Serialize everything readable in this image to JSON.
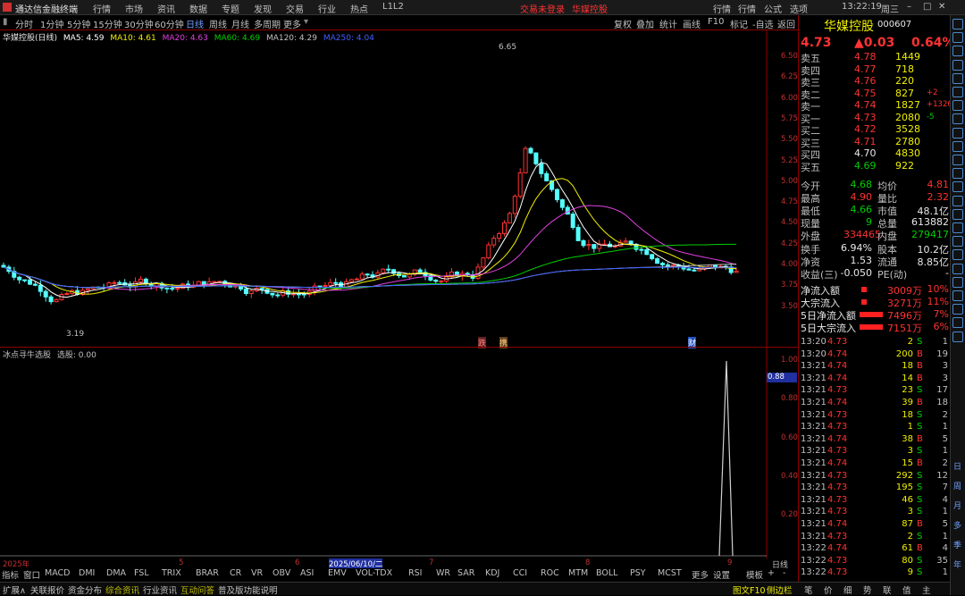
{
  "window": {
    "app": "通达信金融终端",
    "menus": [
      "行情",
      "市场",
      "资讯",
      "数据",
      "专题",
      "发现",
      "交易",
      "行业",
      "热点",
      "L1L2"
    ],
    "notice": "交易未登录",
    "stock_name_title": "华媒控股",
    "right_menus": [
      "行情",
      "行情",
      "公式",
      "选项"
    ],
    "clock": "13:22:19",
    "weekday": "周三"
  },
  "periods": [
    "分时",
    "1分钟",
    "5分钟",
    "15分钟",
    "30分钟",
    "60分钟",
    "日线",
    "周线",
    "月线",
    "多周期",
    "更多"
  ],
  "toolbar_right": [
    "复权",
    "叠加",
    "统计",
    "画线",
    "F10",
    "标记",
    "-自选",
    "返回"
  ],
  "chart": {
    "title": "华媒控股(日线)",
    "ma": [
      {
        "label": "MA5: 4.59",
        "color": "#ffffff"
      },
      {
        "label": "MA10: 4.61",
        "color": "#f0f000"
      },
      {
        "label": "MA20: 4.63",
        "color": "#e040e0"
      },
      {
        "label": "MA60: 4.69",
        "color": "#00d000"
      },
      {
        "label": "MA120: 4.29",
        "color": "#c0c0c0"
      },
      {
        "label": "MA250: 4.04",
        "color": "#4060ff"
      }
    ],
    "y_ticks": [
      "6.50",
      "6.25",
      "6.00",
      "5.75",
      "5.50",
      "5.25",
      "5.00",
      "4.75",
      "4.50",
      "4.25",
      "4.00",
      "3.75",
      "3.50"
    ],
    "high_label": "6.65",
    "low_label": "3.19",
    "markers": [
      "跌",
      "携",
      "财"
    ]
  },
  "indicator": {
    "title": "冰点寻牛选股",
    "value_label": "选股: 0.00",
    "current": "0.88",
    "y_ticks": [
      "1.00",
      "0.80",
      "0.60",
      "0.40",
      "0.20"
    ]
  },
  "x_axis": {
    "labels": [
      "2025年",
      "5",
      "6",
      "2025/06/10/二",
      "7",
      "8",
      "9"
    ],
    "right": "日线"
  },
  "indicator_tabs": [
    "指标",
    "窗口",
    "MACD",
    "DMI",
    "DMA",
    "FSL",
    "TRIX",
    "BRAR",
    "CR",
    "VR",
    "OBV",
    "ASI",
    "EMV",
    "VOL-TDX",
    "RSI",
    "WR",
    "SAR",
    "KDJ",
    "CCI",
    "ROC",
    "MTM",
    "BOLL",
    "PSY",
    "MCST",
    "更多",
    "设置",
    "模板",
    "+",
    "-"
  ],
  "bottom_bar": [
    "扩展∧",
    "关联报价",
    "资金分布",
    "综合资讯",
    "行业资讯",
    "互动问答",
    "普及版功能说明"
  ],
  "bottom_right": [
    "图文F10",
    "侧边栏",
    "笔",
    "价",
    "细",
    "势",
    "联",
    "值",
    "主"
  ],
  "quote": {
    "name": "华媒控股",
    "code": "000607",
    "price": "4.73",
    "change": "▲0.03",
    "pct": "0.64%",
    "asks": [
      [
        "卖五",
        "4.78",
        "1449",
        ""
      ],
      [
        "卖四",
        "4.77",
        "718",
        ""
      ],
      [
        "卖三",
        "4.76",
        "220",
        ""
      ],
      [
        "卖二",
        "4.75",
        "827",
        "+2"
      ],
      [
        "卖一",
        "4.74",
        "1827",
        "+1326"
      ]
    ],
    "bids": [
      [
        "买一",
        "4.73",
        "2080",
        "-5"
      ],
      [
        "买二",
        "4.72",
        "3528",
        ""
      ],
      [
        "买三",
        "4.71",
        "2780",
        ""
      ],
      [
        "买四",
        "4.70",
        "4830",
        ""
      ],
      [
        "买五",
        "4.69",
        "922",
        ""
      ]
    ],
    "stats": [
      [
        "今开",
        "4.68",
        "均价",
        "4.81"
      ],
      [
        "最高",
        "4.90",
        "量比",
        "2.32"
      ],
      [
        "最低",
        "4.66",
        "市值",
        "48.1亿"
      ],
      [
        "现量",
        "9",
        "总量",
        "613882"
      ],
      [
        "外盘",
        "334465",
        "内盘",
        "279417"
      ]
    ],
    "stats2": [
      [
        "换手",
        "6.94%",
        "股本",
        "10.2亿"
      ],
      [
        "净资",
        "1.53",
        "流通",
        "8.85亿"
      ],
      [
        "收益(三)",
        "-0.050",
        "PE(动)",
        "-"
      ]
    ],
    "flows": [
      [
        "净流入额",
        "3009万",
        "10%"
      ],
      [
        "大宗流入",
        "3271万",
        "11%"
      ],
      [
        "5日净流入额",
        "7496万",
        "7%"
      ],
      [
        "5日大宗流入",
        "7151万",
        "6%"
      ]
    ],
    "ticks": [
      [
        "13:20",
        "4.73",
        "2",
        "S",
        "1"
      ],
      [
        "13:20",
        "4.74",
        "200",
        "B",
        "19"
      ],
      [
        "13:21",
        "4.74",
        "18",
        "B",
        "3"
      ],
      [
        "13:21",
        "4.74",
        "14",
        "B",
        "3"
      ],
      [
        "13:21",
        "4.73",
        "23",
        "S",
        "17"
      ],
      [
        "13:21",
        "4.74",
        "39",
        "B",
        "18"
      ],
      [
        "13:21",
        "4.73",
        "18",
        "S",
        "2"
      ],
      [
        "13:21",
        "4.73",
        "1",
        "S",
        "1"
      ],
      [
        "13:21",
        "4.74",
        "38",
        "B",
        "5"
      ],
      [
        "13:21",
        "4.73",
        "3",
        "S",
        "1"
      ],
      [
        "13:21",
        "4.74",
        "15",
        "B",
        "2"
      ],
      [
        "13:21",
        "4.73",
        "292",
        "S",
        "12"
      ],
      [
        "13:21",
        "4.73",
        "195",
        "S",
        "7"
      ],
      [
        "13:21",
        "4.73",
        "46",
        "S",
        "4"
      ],
      [
        "13:21",
        "4.73",
        "3",
        "S",
        "1"
      ],
      [
        "13:21",
        "4.74",
        "87",
        "B",
        "5"
      ],
      [
        "13:21",
        "4.73",
        "2",
        "S",
        "1"
      ],
      [
        "13:22",
        "4.74",
        "61",
        "B",
        "4"
      ],
      [
        "13:22",
        "4.73",
        "80",
        "S",
        "35"
      ],
      [
        "13:22",
        "4.73",
        "9",
        "S",
        "1"
      ]
    ]
  },
  "sidebar": [
    "日",
    "周",
    "月",
    "多",
    "季",
    "年"
  ]
}
